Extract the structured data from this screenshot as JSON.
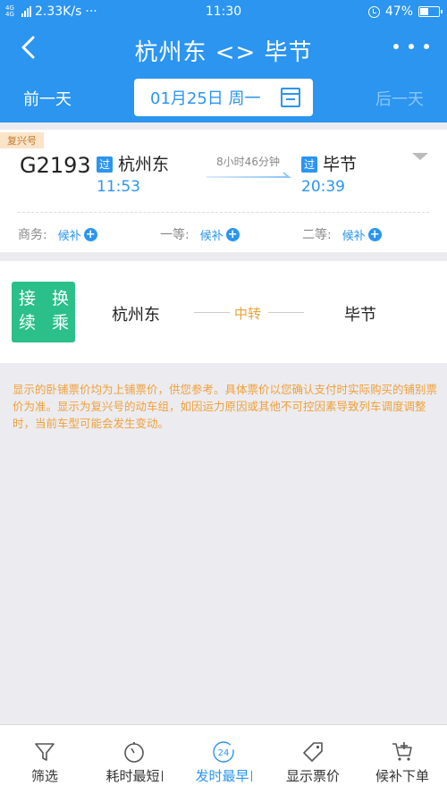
{
  "status_bar": {
    "network": "4G 4G",
    "speed": "2.33K/s",
    "dots": "···",
    "time": "11:30",
    "battery": "47%",
    "battery_level": 0.47
  },
  "header": {
    "title": "杭州东 <> 毕节"
  },
  "date_bar": {
    "prev": "前一天",
    "date": "01月25日 周一",
    "next": "后一天"
  },
  "train": {
    "tag": "复兴号",
    "number": "G2193",
    "pass_badge": "过",
    "from_station": "杭州东",
    "from_time": "11:53",
    "duration": "8小时46分钟",
    "to_station": "毕节",
    "to_time": "20:39",
    "seats": [
      {
        "label": "商务:",
        "status": "候补"
      },
      {
        "label": "一等:",
        "status": "候补"
      },
      {
        "label": "二等:",
        "status": "候补"
      }
    ]
  },
  "transfer": {
    "badge": "接 换\n续 乘",
    "from": "杭州东",
    "middle": "中转",
    "to": "毕节"
  },
  "notice": "显示的卧铺票价均为上铺票价，供您参考。具体票价以您确认支付时实际购买的铺别票价为准。显示为复兴号的动车组，如因运力原因或其他不可控因素导致列车调度调整时，当前车型可能会发生变动。",
  "tabbar": [
    {
      "label": "筛选",
      "icon": "filter-icon"
    },
    {
      "label": "耗时最短",
      "icon": "stopwatch-icon"
    },
    {
      "label": "发时最早",
      "icon": "clock-24-icon"
    },
    {
      "label": "显示票价",
      "icon": "price-tag-icon"
    },
    {
      "label": "候补下单",
      "icon": "cart-plus-icon"
    }
  ],
  "colors": {
    "primary": "#2b95f0",
    "accent_orange": "#f0a038",
    "transfer_green": "#2bbf8a"
  }
}
